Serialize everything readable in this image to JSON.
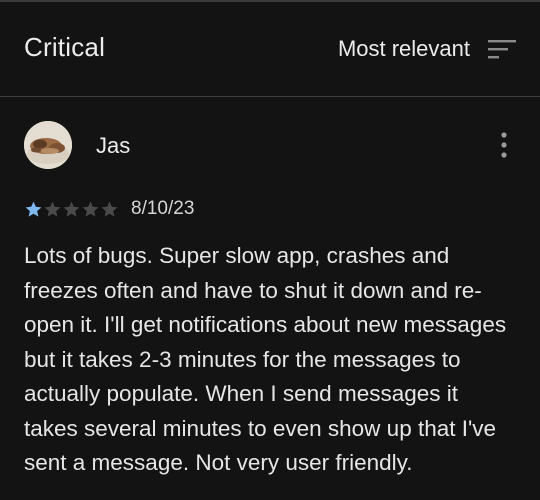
{
  "header": {
    "filter_label": "Critical",
    "sort_label": "Most relevant",
    "sort_icon": "sort-lines-icon"
  },
  "review": {
    "author": "Jas",
    "avatar": "avatar-photo",
    "rating": 1,
    "max_rating": 5,
    "date": "8/10/23",
    "text": "Lots of bugs. Super slow app, crashes and freezes often and have to shut it down and re-open it. I'll get notifications about new messages but it takes 2-3 minutes for the messages to actually populate. When I send messages it takes several minutes to even show up that I've sent a message. Not very user friendly.",
    "more_icon": "more-vert-icon"
  },
  "colors": {
    "background": "#131313",
    "star_filled": "#7fb8ee",
    "star_empty": "#4a4a4a",
    "text": "#e6e6e6"
  }
}
